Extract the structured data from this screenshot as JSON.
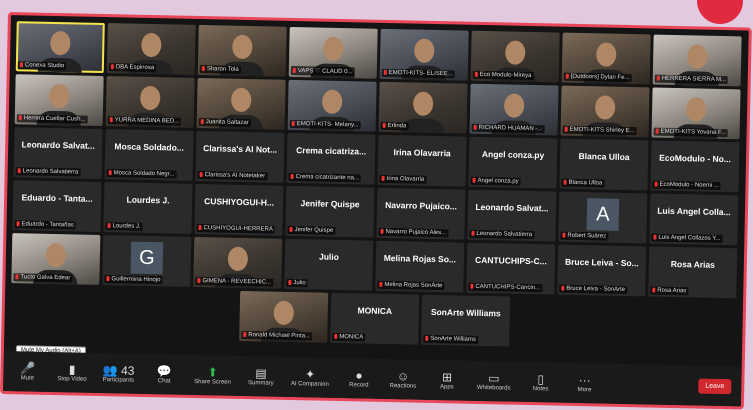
{
  "tooltip": "Mute My Audio (Alt+A)",
  "rows": [
    [
      {
        "kind": "video",
        "style": "v2",
        "label": "Conexa Studio",
        "active": true
      },
      {
        "kind": "video",
        "style": "video",
        "label": "DBA Espinosa"
      },
      {
        "kind": "video",
        "style": "v3",
        "label": "Sharon Tola"
      },
      {
        "kind": "video",
        "style": "v4",
        "label": "VAPS ♡ CLAUD 0..."
      },
      {
        "kind": "video",
        "style": "v2",
        "label": "EMOTI-KITS- ELISEE..."
      },
      {
        "kind": "video",
        "style": "video",
        "label": "Eco Modulo-Mireya"
      },
      {
        "kind": "video",
        "style": "v3",
        "label": "[Outdoors] Dylan Fe..."
      },
      {
        "kind": "video",
        "style": "v4",
        "label": "HERRERA SIERRA M..."
      }
    ],
    [
      {
        "kind": "video",
        "style": "v4",
        "label": "Herrera Cuellar Cush..."
      },
      {
        "kind": "video",
        "style": "video",
        "label": "YURRA MEDINA BED..."
      },
      {
        "kind": "video",
        "style": "v3",
        "label": "Juanita Saltazar"
      },
      {
        "kind": "video",
        "style": "v2",
        "label": "EMOTI-KITS- Melany..."
      },
      {
        "kind": "video",
        "style": "video",
        "label": "Erlinda"
      },
      {
        "kind": "video",
        "style": "v2",
        "label": "RICHARD HUAMAN -..."
      },
      {
        "kind": "video",
        "style": "v3",
        "label": "EMOTI-KITS Shirley E..."
      },
      {
        "kind": "video",
        "style": "v4",
        "label": "EMOTI-KITS Yovana F..."
      }
    ],
    [
      {
        "kind": "name",
        "big": "Leonardo Salvat...",
        "label": "Leonardo Salvatierra"
      },
      {
        "kind": "name",
        "big": "Mosca Soldado...",
        "label": "Mosca Soldado Negr..."
      },
      {
        "kind": "name",
        "big": "Clarissa's AI Not...",
        "label": "Clarissa's AI Notetaker"
      },
      {
        "kind": "name",
        "big": "Crema cicatriza...",
        "label": "Crema cicatrizante na..."
      },
      {
        "kind": "name",
        "big": "Irina Olavarria",
        "label": "Irina Olavarria"
      },
      {
        "kind": "name",
        "big": "Angel conza.py",
        "label": "Angel conza.py"
      },
      {
        "kind": "name",
        "big": "Blanca Ulloa",
        "label": "Blanca Ulloa"
      },
      {
        "kind": "name",
        "big": "EcoModulo - No...",
        "label": "EcoModulo - Noemi ..."
      }
    ],
    [
      {
        "kind": "name",
        "big": "Eduardo - Tanta...",
        "label": "Eduardo - Tantañas"
      },
      {
        "kind": "name",
        "big": "Lourdes J.",
        "label": "Lourdes J."
      },
      {
        "kind": "name",
        "big": "CUSHIYOGUI-H...",
        "label": "CUSHIYOGUI-HERRERA"
      },
      {
        "kind": "name",
        "big": "Jenifer Quispe",
        "label": "Jenifer Quispe"
      },
      {
        "kind": "name",
        "big": "Navarro Pujaico...",
        "label": "Navarro Pujaico Ales..."
      },
      {
        "kind": "name",
        "big": "Leonardo Salvat...",
        "label": "Leonardo Salvatierra"
      },
      {
        "kind": "avatar",
        "letter": "A",
        "label": "Robert Suárez"
      },
      {
        "kind": "name",
        "big": "Luis Angel Colla...",
        "label": "Luis Angel Collazos Y..."
      }
    ],
    [
      {
        "kind": "video",
        "style": "v4",
        "label": "Tucto Galva Edear"
      },
      {
        "kind": "avatar",
        "letter": "G",
        "label": "Guillermina Hinojo"
      },
      {
        "kind": "video",
        "style": "video",
        "label": "GIMENA - REVEECHIC..."
      },
      {
        "kind": "name",
        "big": "Julio",
        "label": "Julio"
      },
      {
        "kind": "name",
        "big": "Melina Rojas So...",
        "label": "Melina Rojas SonArte"
      },
      {
        "kind": "name",
        "big": "CANTUCHIPS-C...",
        "label": "CANTUCHIPS-Cancin..."
      },
      {
        "kind": "name",
        "big": "Bruce Leiva - So...",
        "label": "Bruce Leiva - SonArte"
      },
      {
        "kind": "name",
        "big": "Rosa Arias",
        "label": "Rosa Arias"
      }
    ],
    [
      {
        "kind": "video",
        "style": "v3",
        "label": "Ronald Michael Pinta..."
      },
      {
        "kind": "name",
        "big": "MONICA",
        "label": "MONICA"
      },
      {
        "kind": "name",
        "big": "SonArte Williams",
        "label": "SonArte Williams"
      }
    ]
  ],
  "toolbar": {
    "items": [
      {
        "name": "mute",
        "icon": "🎤",
        "label": "Mute"
      },
      {
        "name": "stop-video",
        "icon": "▮",
        "label": "Stop Video"
      },
      {
        "name": "participants",
        "icon": "👥 43",
        "label": "Participants"
      },
      {
        "name": "chat",
        "icon": "💬",
        "label": "Chat"
      },
      {
        "name": "share-screen",
        "icon": "⬆",
        "label": "Share Screen",
        "green": true
      },
      {
        "name": "summary",
        "icon": "▤",
        "label": "Summary"
      },
      {
        "name": "ai-companion",
        "icon": "✦",
        "label": "AI Companion"
      },
      {
        "name": "record",
        "icon": "●",
        "label": "Record"
      },
      {
        "name": "reactions",
        "icon": "☺",
        "label": "Reactions"
      },
      {
        "name": "apps",
        "icon": "⊞",
        "label": "Apps"
      },
      {
        "name": "whiteboards",
        "icon": "▭",
        "label": "Whiteboards"
      },
      {
        "name": "notes",
        "icon": "▯",
        "label": "Notes"
      },
      {
        "name": "more",
        "icon": "···",
        "label": "More"
      }
    ],
    "leave_label": "Leave"
  },
  "colors": {
    "accent": "#e8475a",
    "leave": "#d0282e",
    "share": "#2fbd4e",
    "active_speaker": "#f4e34a"
  }
}
